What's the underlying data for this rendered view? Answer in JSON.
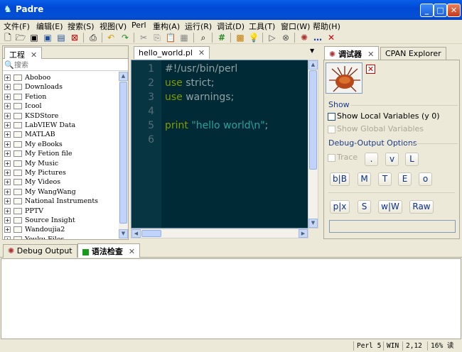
{
  "window": {
    "title": "Padre",
    "icon": "camel-icon"
  },
  "menus": [
    "文件(F)",
    "编辑(E)",
    "搜索(S)",
    "视图(V)",
    "Perl",
    "重构(A)",
    "运行(R)",
    "调试(D)",
    "工具(T)",
    "窗口(W)",
    "帮助(H)"
  ],
  "left_panel": {
    "tab_label": "工程",
    "tab_close": "✕",
    "search_placeholder": "搜索",
    "tree": [
      "Aboboo",
      "Downloads",
      "Fetion",
      "Icool",
      "KSDStore",
      "LabVIEW Data",
      "MATLAB",
      "My eBooks",
      "My Fetion file",
      "My Music",
      "My Pictures",
      "My Videos",
      "My WangWang",
      "National Instruments",
      "PPTV",
      "Source Insight",
      "Wandoujia2",
      "Youku Files"
    ]
  },
  "editor": {
    "tab_label": "hello_world.pl",
    "tab_close": "✕",
    "menu_arrow": "▼",
    "line_numbers": [
      "1",
      "2",
      "3",
      "4",
      "5",
      "6"
    ],
    "lines": {
      "l1": "#!/usr/bin/perl",
      "l2_kw": "use",
      "l2_rest": " strict;",
      "l3_kw": "use",
      "l3_rest": " warnings;",
      "l5_kw": "print",
      "l5_str": " \"hello world\\n\"",
      "l5_end": ";"
    },
    "colors": {
      "background": "#002b36",
      "keyword": "#859900",
      "string": "#2aa198",
      "text": "#93a1a1"
    }
  },
  "right_panel": {
    "tabs": [
      {
        "label": "调试器"
      },
      {
        "label": "CPAN Explorer"
      }
    ],
    "tab_close": "✕",
    "show_label": "Show",
    "show_local": "Show Local Variables (y 0)",
    "show_global": "Show Global Variables",
    "debug_output_label": "Debug-Output Options",
    "trace": "Trace",
    "row1_buttons": [
      ".",
      "v",
      "L"
    ],
    "row2_buttons": [
      "b|B",
      "M",
      "T",
      "E",
      "o"
    ],
    "row3_buttons": [
      "p|x",
      "S",
      "w|W",
      "Raw"
    ]
  },
  "bottom": {
    "tabs": [
      {
        "label": "Debug Output"
      },
      {
        "label": "语法检查"
      }
    ],
    "tab_close": "✕"
  },
  "status": {
    "language": "Perl 5",
    "eol": "WIN",
    "position": "2,12",
    "percent": "16% 读"
  }
}
